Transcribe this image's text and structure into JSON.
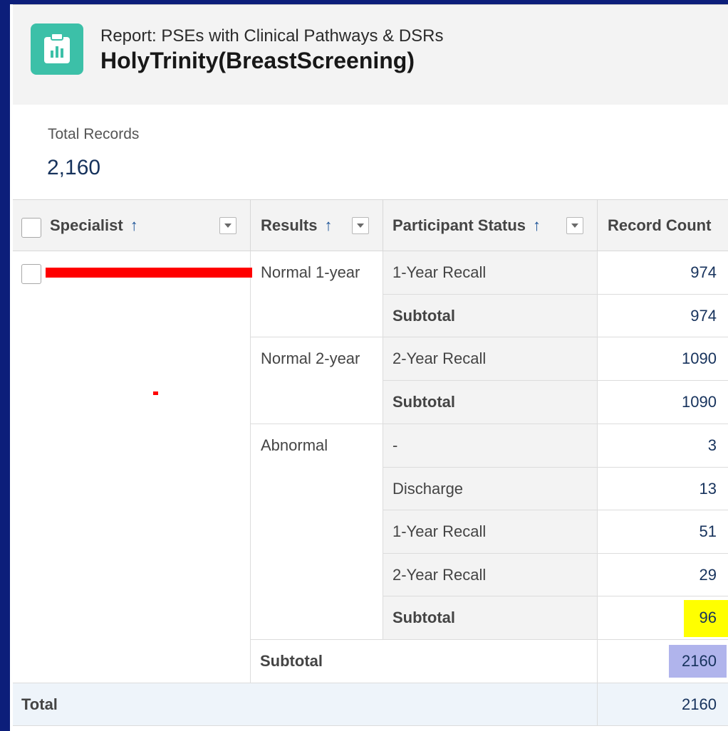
{
  "report": {
    "subtitle": "Report: PSEs with Clinical Pathways & DSRs",
    "title": "HolyTrinity(BreastScreening)",
    "icon": "report-chart-icon",
    "accent": "#3cc0a8"
  },
  "summary": {
    "label": "Total Records",
    "value": "2,160"
  },
  "columns": {
    "specialist": "Specialist",
    "results": "Results",
    "participant_status": "Participant Status",
    "record_count": "Record Count",
    "sort_glyph": "↑"
  },
  "groups": [
    {
      "result": "Normal 1-year",
      "rows": [
        {
          "status": "1-Year Recall",
          "count": "974"
        }
      ],
      "subtotal_label": "Subtotal",
      "subtotal": "974"
    },
    {
      "result": "Normal 2-year",
      "rows": [
        {
          "status": "2-Year Recall",
          "count": "1090"
        }
      ],
      "subtotal_label": "Subtotal",
      "subtotal": "1090"
    },
    {
      "result": "Abnormal",
      "rows": [
        {
          "status": "-",
          "count": "3"
        },
        {
          "status": "Discharge",
          "count": "13"
        },
        {
          "status": "1-Year Recall",
          "count": "51"
        },
        {
          "status": "2-Year Recall",
          "count": "29"
        }
      ],
      "subtotal_label": "Subtotal",
      "subtotal": "96"
    }
  ],
  "specialist_subtotal": {
    "label": "Subtotal",
    "count": "2160"
  },
  "grand_total": {
    "label": "Total",
    "count": "2160"
  },
  "colors": {
    "highlight_yellow": "#ffff00",
    "highlight_blue": "#b0b4ec",
    "redaction": "#ff0000",
    "frame": "#0c1e7a"
  }
}
